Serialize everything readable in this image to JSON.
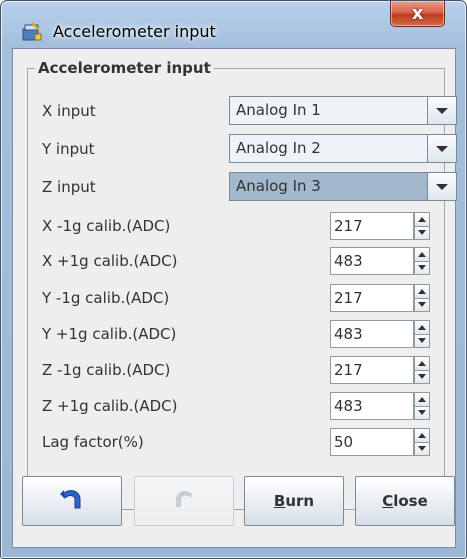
{
  "window": {
    "title": "Accelerometer input",
    "close_label": "x"
  },
  "group": {
    "title": "Accelerometer input"
  },
  "selects": [
    {
      "label": "X input",
      "value": "Analog In 1",
      "selected": false
    },
    {
      "label": "Y input",
      "value": "Analog In 2",
      "selected": false
    },
    {
      "label": "Z input",
      "value": "Analog In 3",
      "selected": true
    }
  ],
  "fields": [
    {
      "label": "X -1g calib.(ADC)",
      "value": "217"
    },
    {
      "label": "X +1g calib.(ADC)",
      "value": "483"
    },
    {
      "label": "Y -1g calib.(ADC)",
      "value": "217"
    },
    {
      "label": "Y +1g calib.(ADC)",
      "value": "483"
    },
    {
      "label": "Z -1g calib.(ADC)",
      "value": "217"
    },
    {
      "label": "Z +1g calib.(ADC)",
      "value": "483"
    },
    {
      "label": "Lag factor(%)",
      "value": "50"
    }
  ],
  "buttons": {
    "undo_icon": "undo-arrow-icon",
    "redo_icon": "redo-arrow-icon",
    "burn": {
      "mnemonic": "B",
      "rest": "urn"
    },
    "close": {
      "mnemonic": "C",
      "rest": "lose"
    }
  },
  "colors": {
    "selected_combo": "#a3b8cc",
    "title_close": "#c13a1f",
    "undo_icon": "#1f4fb0"
  }
}
